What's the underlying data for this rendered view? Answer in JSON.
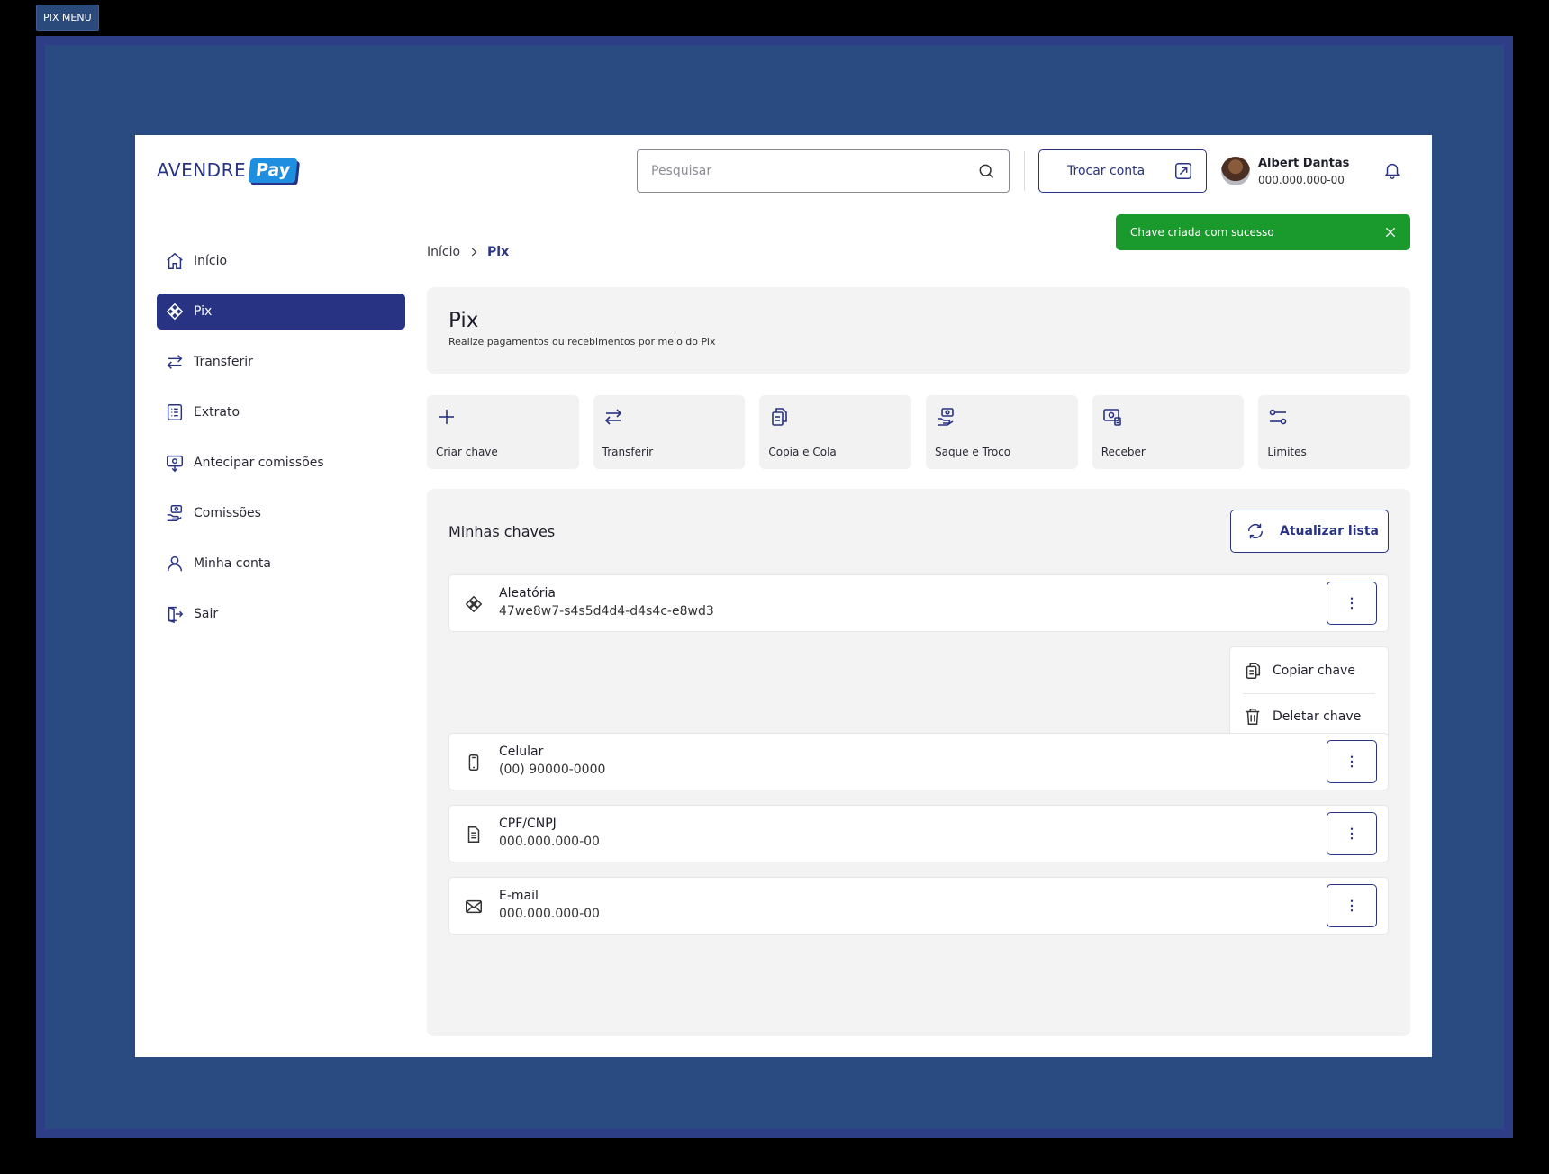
{
  "frame_label": "PIX MENU",
  "header": {
    "logo_text": "AVENDRE",
    "logo_badge": "Pay",
    "search_placeholder": "Pesquisar",
    "switch_account_label": "Trocar conta",
    "user_name": "Albert Dantas",
    "user_document": "000.000.000-00"
  },
  "toast": {
    "message": "Chave criada com sucesso",
    "color": "#1a9a2c"
  },
  "sidebar": {
    "items": [
      {
        "label": "Início",
        "icon": "home-icon"
      },
      {
        "label": "Pix",
        "icon": "pix-icon",
        "active": true
      },
      {
        "label": "Transferir",
        "icon": "transfer-icon"
      },
      {
        "label": "Extrato",
        "icon": "statement-icon"
      },
      {
        "label": "Antecipar comissões",
        "icon": "anticipate-icon"
      },
      {
        "label": "Comissões",
        "icon": "commissions-icon"
      },
      {
        "label": "Minha conta",
        "icon": "user-icon"
      },
      {
        "label": "Sair",
        "icon": "logout-icon"
      }
    ]
  },
  "breadcrumb": {
    "home": "Início",
    "current": "Pix"
  },
  "page": {
    "title": "Pix",
    "subtitle": "Realize pagamentos ou recebimentos por meio do Pix"
  },
  "actions": [
    {
      "label": "Criar chave",
      "icon": "plus-icon"
    },
    {
      "label": "Transferir",
      "icon": "transfer-icon"
    },
    {
      "label": "Copia e Cola",
      "icon": "copy-icon"
    },
    {
      "label": "Saque e Troco",
      "icon": "cash-hand-icon"
    },
    {
      "label": "Receber",
      "icon": "receive-icon"
    },
    {
      "label": "Limites",
      "icon": "sliders-icon"
    }
  ],
  "keys": {
    "title": "Minhas chaves",
    "refresh_label": "Atualizar lista",
    "items": [
      {
        "type": "Aleatória",
        "value": "47we8w7-s4s5d4d4-d4s4c-e8wd3",
        "icon": "pix-icon"
      },
      {
        "type": "Celular",
        "value": "(00) 90000-0000",
        "icon": "phone-icon"
      },
      {
        "type": "CPF/CNPJ",
        "value": "000.000.000-00",
        "icon": "document-icon"
      },
      {
        "type": "E-mail",
        "value": "000.000.000-00",
        "icon": "mail-icon"
      }
    ],
    "menu": {
      "copy_label": "Copiar chave",
      "delete_label": "Deletar chave"
    }
  },
  "colors": {
    "primary": "#283384",
    "panel_bg": "#f3f3f3",
    "outer_bg": "#294b82"
  }
}
